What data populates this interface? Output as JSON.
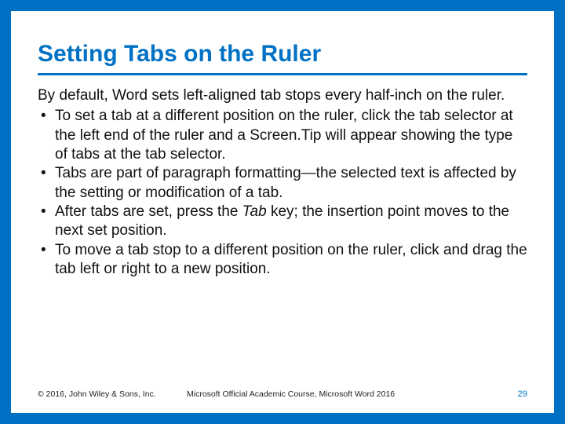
{
  "title": "Setting Tabs on the Ruler",
  "intro": "By default, Word sets left-aligned tab stops every half-inch on the ruler.",
  "bullets": [
    "To set a tab at a different position on the ruler, click the tab selector at the left end of the ruler and a Screen.Tip will appear showing the type of tabs at the tab selector.",
    "Tabs are part of paragraph formatting—the selected text is affected by the setting or modification of a tab.",
    "After tabs are set, press the Tab key; the insertion point moves to the next set position.",
    "To move a tab stop to a different position on the ruler, click and drag the tab left or right to a new position."
  ],
  "bullet_tabkey": {
    "prefix": "After tabs are set, press the ",
    "italic": "Tab",
    "suffix": " key; the insertion point moves to the next set position."
  },
  "footer": {
    "left": "© 2016, John Wiley & Sons, Inc.",
    "center": "Microsoft Official Academic Course, Microsoft Word 2016",
    "page": "29"
  }
}
